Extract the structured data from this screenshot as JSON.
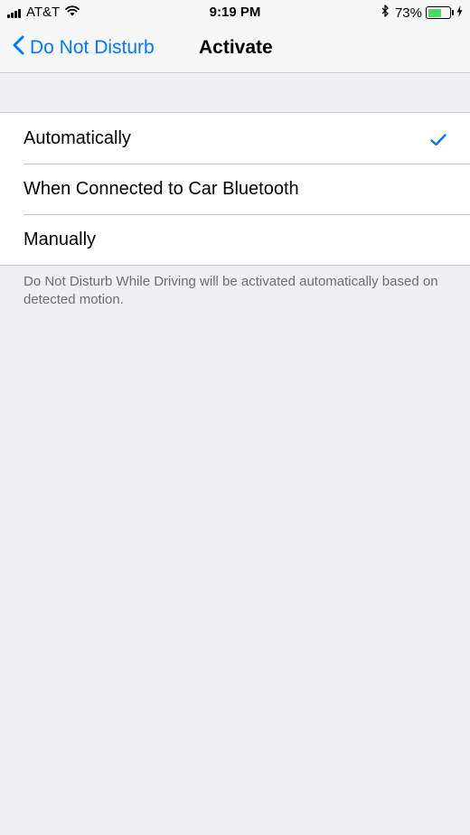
{
  "status_bar": {
    "carrier": "AT&T",
    "time": "9:19 PM",
    "battery_percent": "73%",
    "battery_level": 0.73,
    "battery_color": "#4CD964"
  },
  "nav": {
    "back_label": "Do Not Disturb",
    "title": "Activate",
    "accent_color": "#007AFF"
  },
  "options": [
    {
      "label": "Automatically",
      "selected": true
    },
    {
      "label": "When Connected to Car Bluetooth",
      "selected": false
    },
    {
      "label": "Manually",
      "selected": false
    }
  ],
  "footer": "Do Not Disturb While Driving will be activated automatically based on detected motion."
}
